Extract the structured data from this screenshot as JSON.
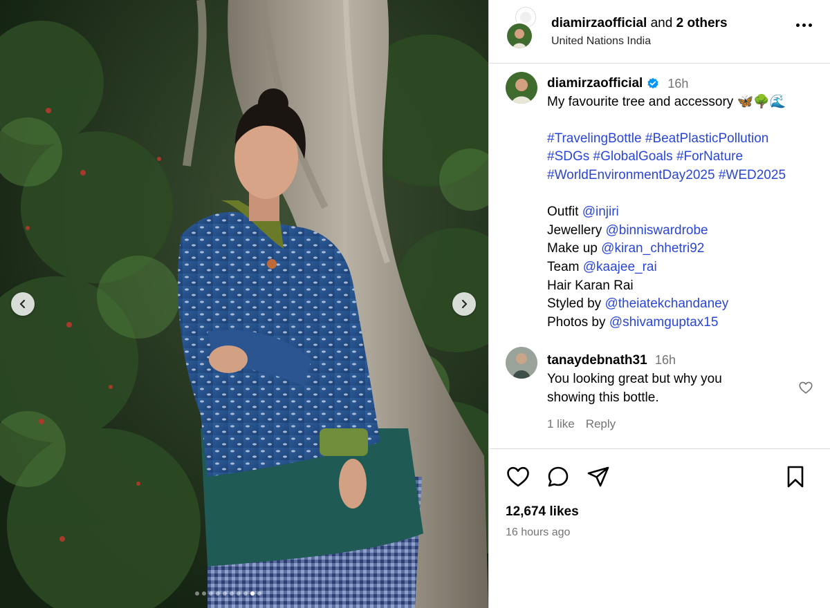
{
  "header": {
    "username": "diamirzaofficial",
    "joiner": " and ",
    "others": "2 others",
    "location": "United Nations India"
  },
  "caption": {
    "username": "diamirzaofficial",
    "time": "16h",
    "text": "My favourite tree and accessory 🦋🌳🌊",
    "hashtags_line1": [
      "#TravelingBottle",
      "#BeatPlasticPollution"
    ],
    "hashtags_line2": [
      "#SDGs",
      "#GlobalGoals",
      "#ForNature"
    ],
    "hashtags_line3": [
      "#WorldEnvironmentDay2025",
      "#WED2025"
    ],
    "credits": [
      {
        "label": "Outfit",
        "mention": "@injiri"
      },
      {
        "label": "Jewellery",
        "mention": "@binniswardrobe"
      },
      {
        "label": "Make up",
        "mention": "@kiran_chhetri92"
      },
      {
        "label": "Team",
        "mention": "@kaajee_rai"
      },
      {
        "label": "Hair Karan Rai",
        "mention": ""
      },
      {
        "label": "Styled by",
        "mention": "@theiatekchandaney"
      },
      {
        "label": "Photos by",
        "mention": "@shivamguptax15"
      }
    ]
  },
  "comment": {
    "username": "tanaydebnath31",
    "time": "16h",
    "line1": "You looking great but why you",
    "line2": "showing this bottle.",
    "likes": "1 like",
    "reply": "Reply"
  },
  "post": {
    "likes": "12,674 likes",
    "time_ago": "16 hours ago"
  },
  "carousel": {
    "total_dots": 10,
    "active_index": 8
  },
  "colors": {
    "link": "#2a46d6",
    "verified": "#0095f6",
    "muted": "#737373"
  }
}
